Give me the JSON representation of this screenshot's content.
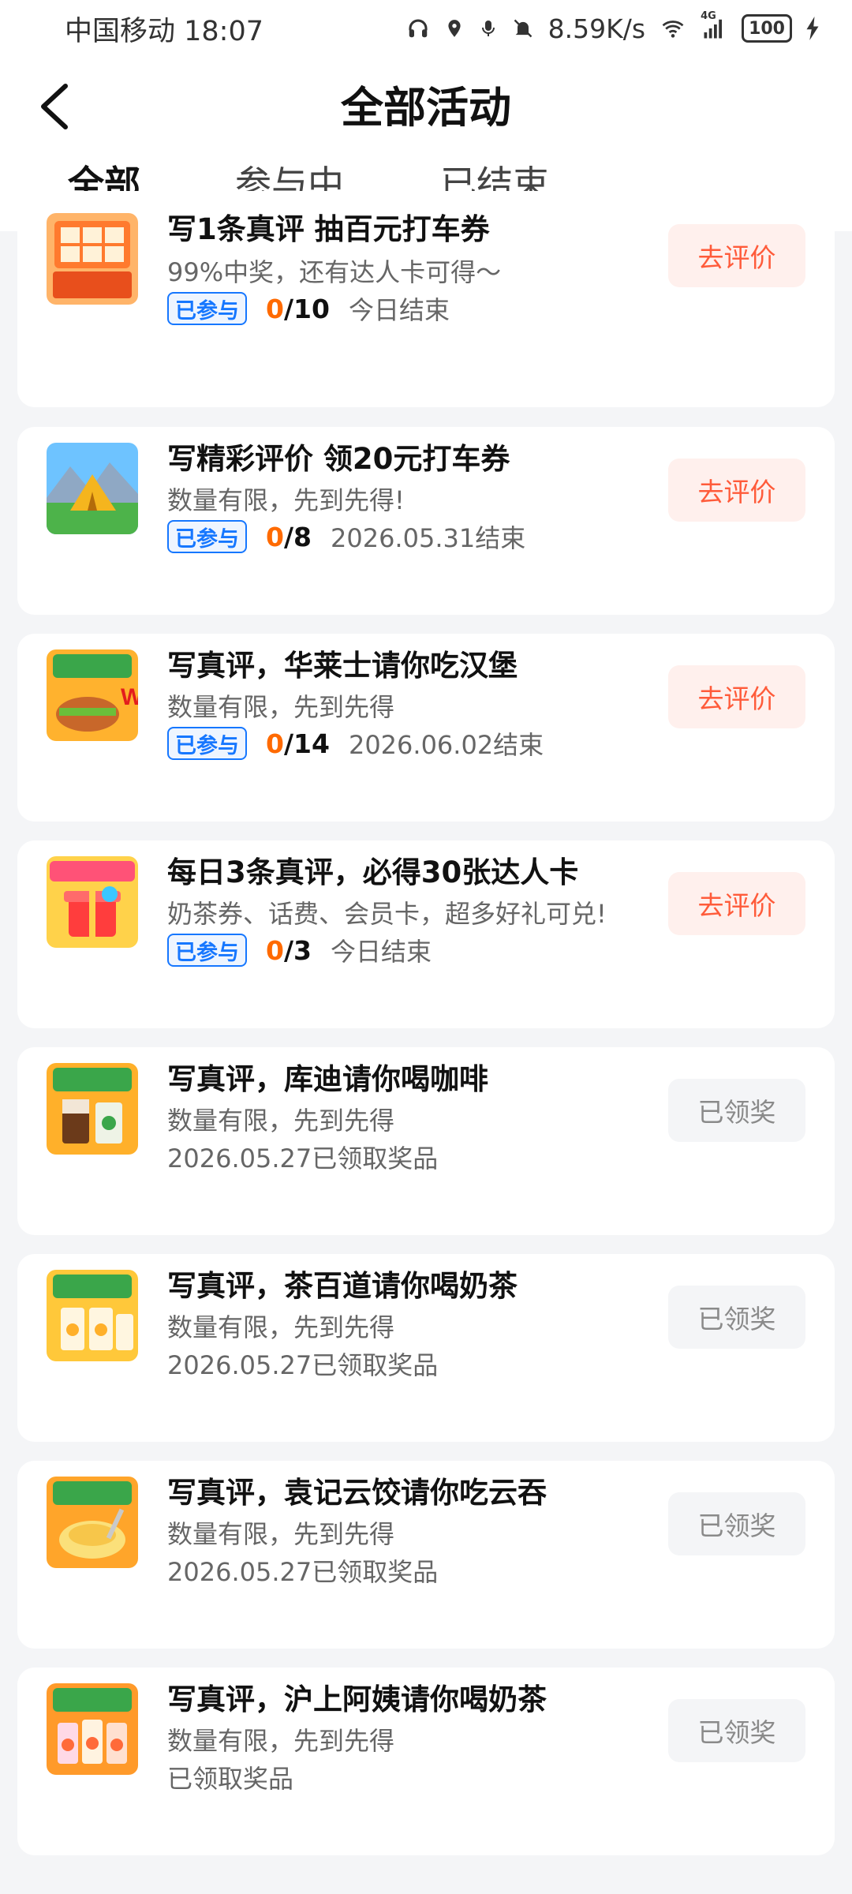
{
  "status_bar": {
    "carrier_time": "中国移动 18:07",
    "net_speed": "8.59K/s",
    "network": "4G",
    "battery": "100",
    "icons": [
      "headphones-icon",
      "location-icon",
      "mic-icon",
      "mute-icon",
      "wifi-icon",
      "signal-icon",
      "battery-icon",
      "charging-icon"
    ]
  },
  "header": {
    "title": "全部活动",
    "back_icon": "chevron-left-icon"
  },
  "tabs": [
    {
      "label": "全部",
      "active": true
    },
    {
      "label": "参与中",
      "active": false
    },
    {
      "label": "已结束",
      "active": false
    }
  ],
  "activities": [
    {
      "title": "写1条真评 抽百元打车券",
      "desc": "99%中奖，还有达人卡可得～",
      "badge": "已参与",
      "progress_current": "0",
      "progress_total": "/10",
      "end": "今日结束",
      "action": "去评价",
      "state": "go"
    },
    {
      "title": "写精彩评价 领20元打车券",
      "desc": "数量有限，先到先得!",
      "badge": "已参与",
      "progress_current": "0",
      "progress_total": "/8",
      "end": "2026.05.31结束",
      "action": "去评价",
      "state": "go"
    },
    {
      "title": "写真评，华莱士请你吃汉堡",
      "desc": "数量有限，先到先得",
      "badge": "已参与",
      "progress_current": "0",
      "progress_total": "/14",
      "end": "2026.06.02结束",
      "action": "去评价",
      "state": "go"
    },
    {
      "title": "每日3条真评，必得30张达人卡",
      "desc": "奶茶券、话费、会员卡，超多好礼可兑!",
      "badge": "已参与",
      "progress_current": "0",
      "progress_total": "/3",
      "end": "今日结束",
      "action": "去评价",
      "state": "go"
    },
    {
      "title": "写真评，库迪请你喝咖啡",
      "desc": "数量有限，先到先得",
      "end": "2026.05.27已领取奖品",
      "action": "已领奖",
      "state": "done"
    },
    {
      "title": "写真评，茶百道请你喝奶茶",
      "desc": "数量有限，先到先得",
      "end": "2026.05.27已领取奖品",
      "action": "已领奖",
      "state": "done"
    },
    {
      "title": "写真评，袁记云饺请你吃云吞",
      "desc": "数量有限，先到先得",
      "end": "2026.05.27已领取奖品",
      "action": "已领奖",
      "state": "done"
    },
    {
      "title": "写真评，沪上阿姨请你喝奶茶",
      "desc": "数量有限，先到先得",
      "end": "已领取奖品",
      "action": "已领奖",
      "state": "done"
    }
  ],
  "colors": {
    "accent": "#1677ff",
    "orange": "#ff6a00",
    "cta": "#ff5b3a"
  }
}
